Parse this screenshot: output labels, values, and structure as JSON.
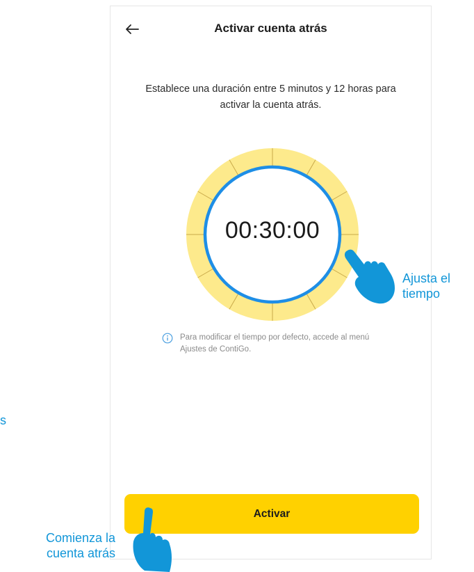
{
  "header": {
    "back_icon": "arrow-left-icon",
    "title": "Activar cuenta atrás"
  },
  "description": "Establece una duración entre 5 minutos y 12 horas para activar la cuenta atrás.",
  "timer": {
    "value": "00:30:00",
    "ring_outer_color": "#fdea8c",
    "ring_inner_color": "#1e8ee6"
  },
  "info": {
    "icon": "info-circle-icon",
    "text": "Para modificar el tiempo por defecto, accede al menú Ajustes de ContiGo."
  },
  "activate_button": {
    "label": "Activar",
    "color": "#ffd100"
  },
  "annotations": {
    "adjust_time": "Ajusta el tiempo",
    "start_countdown": "Comienza la cuenta atrás",
    "partial_left": "s",
    "color": "#1296d8"
  }
}
